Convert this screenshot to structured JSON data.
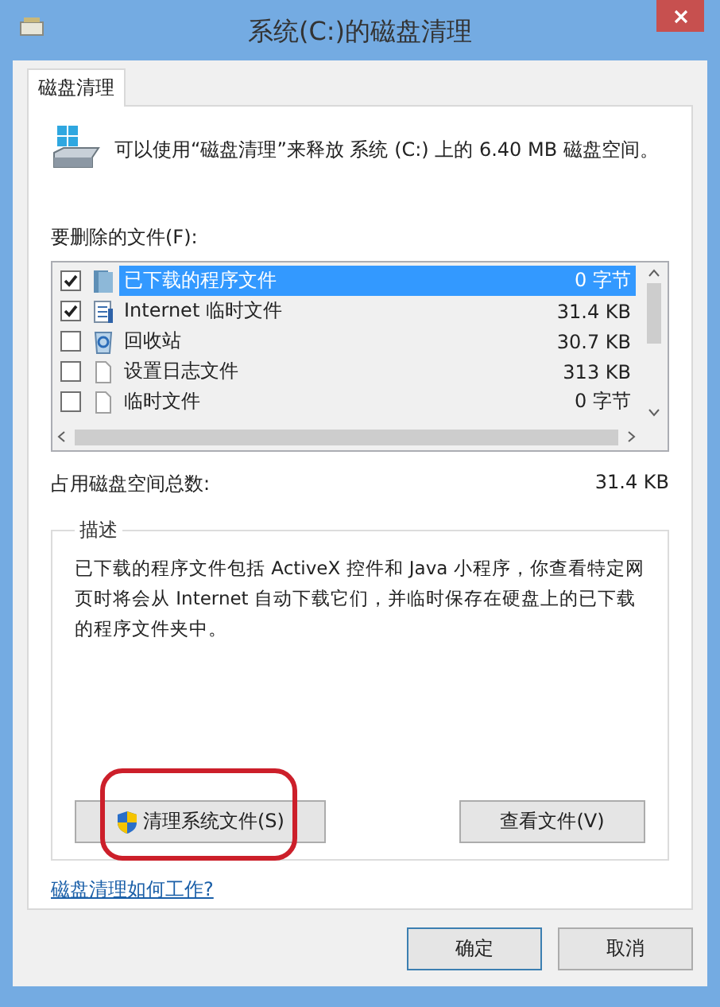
{
  "window": {
    "title": "系统(C:)的磁盘清理"
  },
  "tabs": [
    {
      "label": "磁盘清理",
      "selected": true
    }
  ],
  "header": {
    "message": "可以使用“磁盘清理”来释放 系统 (C:) 上的 6.40 MB 磁盘空间。"
  },
  "files_label": "要删除的文件(F):",
  "files": [
    {
      "kind": "program",
      "name": "已下载的程序文件",
      "size": "0 字节",
      "checked": true,
      "selected": true
    },
    {
      "kind": "internet",
      "name": "Internet 临时文件",
      "size": "31.4 KB",
      "checked": true,
      "selected": false
    },
    {
      "kind": "recycle",
      "name": "回收站",
      "size": "30.7 KB",
      "checked": false,
      "selected": false
    },
    {
      "kind": "page",
      "name": "设置日志文件",
      "size": "313 KB",
      "checked": false,
      "selected": false
    },
    {
      "kind": "page",
      "name": "临时文件",
      "size": "0 字节",
      "checked": false,
      "selected": false
    }
  ],
  "total": {
    "label": "占用磁盘空间总数:",
    "value": "31.4 KB"
  },
  "description": {
    "legend": "描述",
    "text": "已下载的程序文件包括 ActiveX 控件和 Java 小程序，你查看特定网页时将会从 Internet 自动下载它们，并临时保存在硬盘上的已下载的程序文件夹中。"
  },
  "panel_buttons": [
    {
      "kind": "shield",
      "label": "清理系统文件(S)",
      "highlighted": true
    },
    {
      "kind": "plain",
      "label": "查看文件(V)",
      "highlighted": false
    }
  ],
  "help_link": "磁盘清理如何工作?",
  "dialog_buttons": [
    {
      "label": "确定",
      "default": true
    },
    {
      "label": "取消",
      "default": false
    }
  ]
}
